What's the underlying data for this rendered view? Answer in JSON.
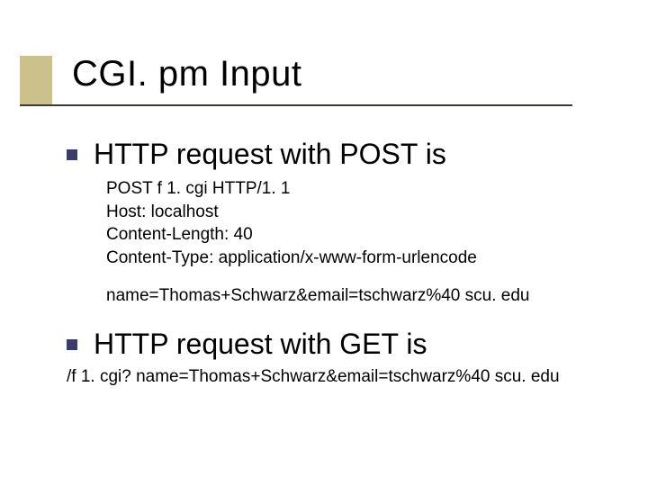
{
  "title": "CGI. pm Input",
  "bullets": {
    "post_heading": "HTTP request with POST is",
    "get_heading": "HTTP request with GET is"
  },
  "post_block": {
    "line1": "POST f 1. cgi HTTP/1. 1",
    "line2": "Host: localhost",
    "line3": "Content-Length: 40",
    "line4": "Content-Type: application/x-www-form-urlencode",
    "body": "name=Thomas+Schwarz&email=tschwarz%40 scu. edu"
  },
  "get_block": {
    "line1": "/f 1. cgi? name=Thomas+Schwarz&email=tschwarz%40 scu. edu"
  }
}
